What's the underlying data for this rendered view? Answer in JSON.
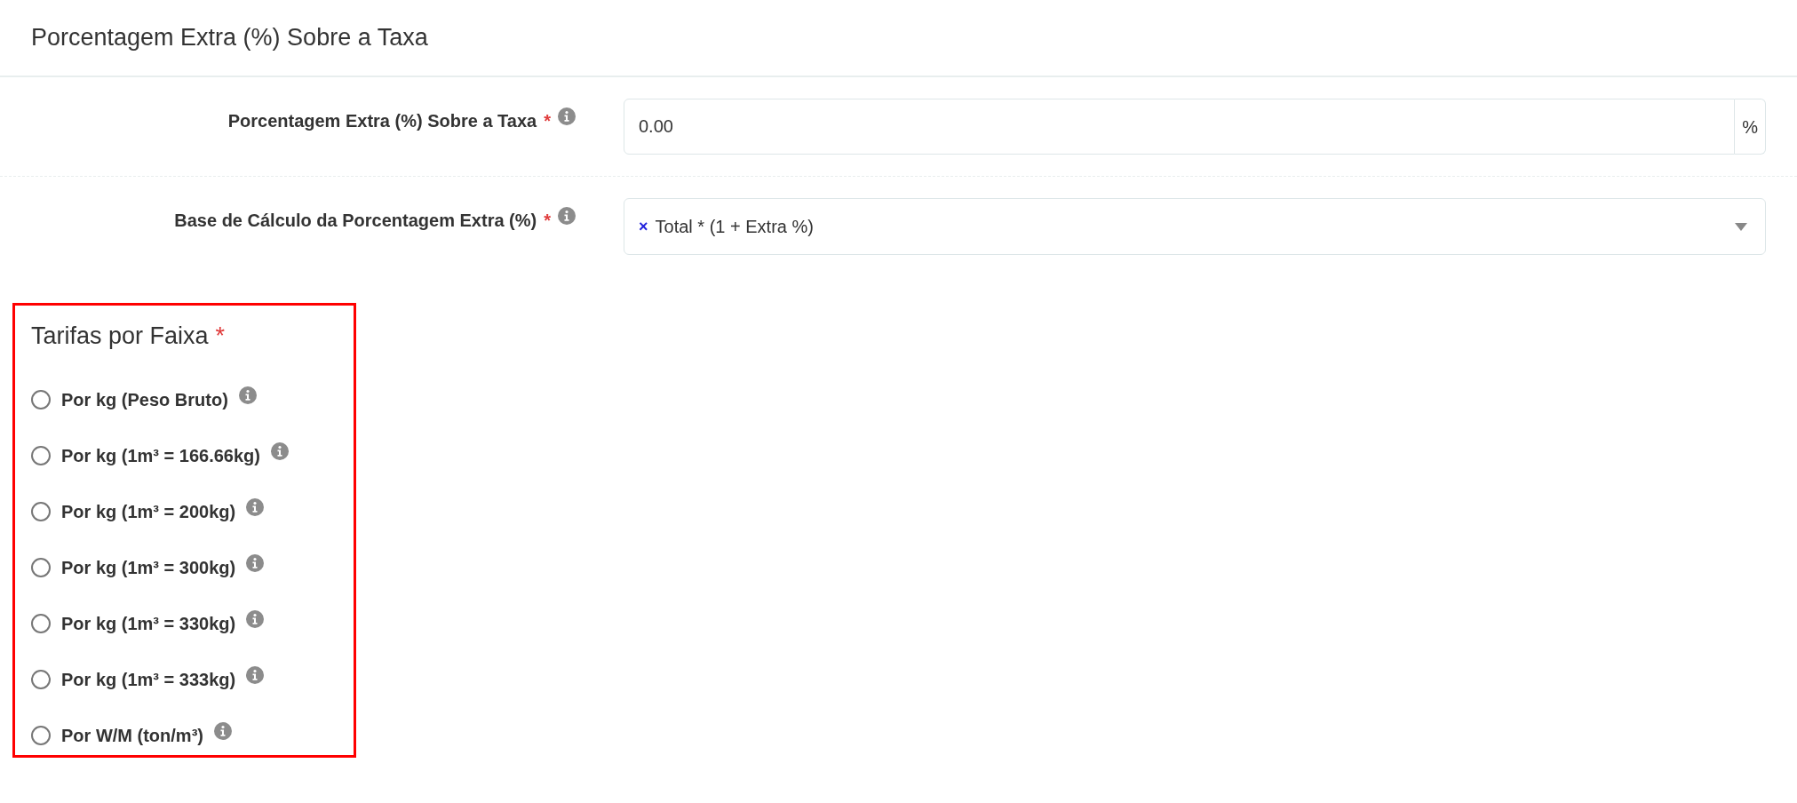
{
  "section_title": "Porcentagem Extra (%) Sobre a Taxa",
  "fields": [
    {
      "kind": "input",
      "label": "Porcentagem Extra (%) Sobre a Taxa",
      "required_mark": "*",
      "value": "0.00",
      "suffix": "%"
    },
    {
      "kind": "select",
      "label": "Base de Cálculo da Porcentagem Extra (%)",
      "required_mark": "*",
      "remove_mark": "×",
      "value": "Total * (1 + Extra %)"
    }
  ],
  "rate_group": {
    "title": "Tarifas por Faixa",
    "required_mark": "*",
    "options": [
      {
        "label": "Por kg (Peso Bruto)",
        "selected": false
      },
      {
        "label": "Por kg (1m³ = 166.66kg)",
        "selected": false
      },
      {
        "label": "Por kg (1m³ = 200kg)",
        "selected": false
      },
      {
        "label": "Por kg (1m³ = 300kg)",
        "selected": false
      },
      {
        "label": "Por kg (1m³ = 330kg)",
        "selected": false
      },
      {
        "label": "Por kg (1m³ = 333kg)",
        "selected": false
      },
      {
        "label": "Por W/M (ton/m³)",
        "selected": false
      }
    ]
  }
}
